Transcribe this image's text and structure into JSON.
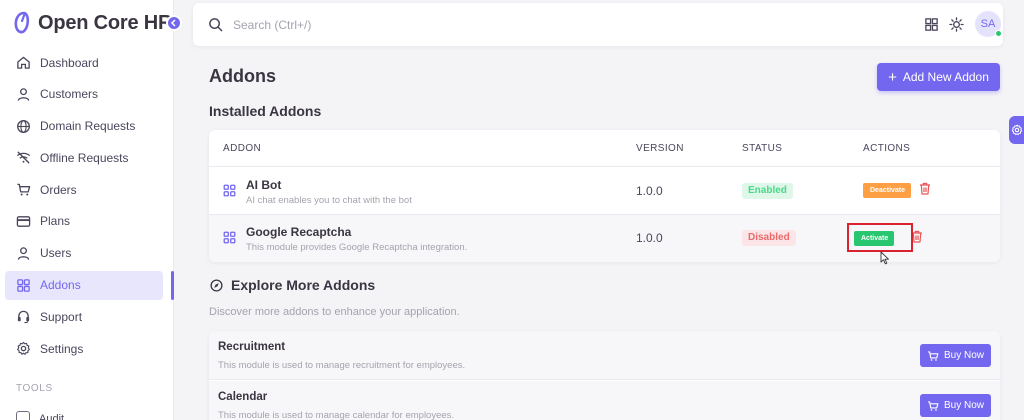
{
  "brand": {
    "name": "Open Core HR"
  },
  "sidebar": {
    "items": [
      {
        "label": "Dashboard",
        "icon": "home-icon"
      },
      {
        "label": "Customers",
        "icon": "user-icon"
      },
      {
        "label": "Domain Requests",
        "icon": "globe-icon"
      },
      {
        "label": "Offline Requests",
        "icon": "wifi-off-icon"
      },
      {
        "label": "Orders",
        "icon": "cart-icon"
      },
      {
        "label": "Plans",
        "icon": "credit-card-icon"
      },
      {
        "label": "Users",
        "icon": "user-icon"
      },
      {
        "label": "Addons",
        "icon": "grid-icon",
        "active": true
      },
      {
        "label": "Support",
        "icon": "headset-icon"
      },
      {
        "label": "Settings",
        "icon": "gear-icon"
      }
    ],
    "section_label": "TOOLS",
    "peek_label": "Audit"
  },
  "topbar": {
    "search_placeholder": "Search (Ctrl+/)",
    "avatar_initials": "SA"
  },
  "page": {
    "title": "Addons",
    "add_button_label": "Add New Addon",
    "installed_title": "Installed Addons"
  },
  "table": {
    "headers": [
      "ADDON",
      "VERSION",
      "STATUS",
      "ACTIONS"
    ],
    "rows": [
      {
        "name": "AI Bot",
        "description": "AI chat enables you to chat with the bot",
        "version": "1.0.0",
        "status": "Enabled",
        "action": "Deactivate"
      },
      {
        "name": "Google Recaptcha",
        "description": "This module provides Google Recaptcha integration.",
        "version": "1.0.0",
        "status": "Disabled",
        "action": "Activate"
      }
    ]
  },
  "explore": {
    "title": "Explore More Addons",
    "subtitle": "Discover more addons to enhance your application.",
    "items": [
      {
        "name": "Recruitment",
        "description": "This module is used to manage recruitment for employees.",
        "button": "Buy Now"
      },
      {
        "name": "Calendar",
        "description": "This module is used to manage calendar for employees.",
        "button": "Buy Now"
      }
    ]
  },
  "colors": {
    "primary": "#7367f0",
    "success": "#28c76f",
    "warning": "#ff9f43",
    "danger": "#ea5455",
    "highlight_box": "#d9232f"
  }
}
